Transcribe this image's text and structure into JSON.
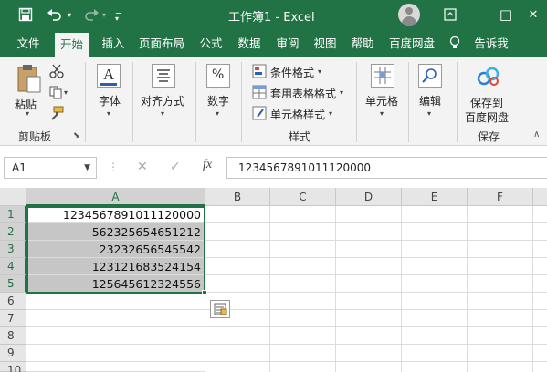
{
  "titlebar": {
    "title": "工作簿1  -  Excel",
    "save_icon": "save-icon",
    "undo_icon": "undo-icon",
    "redo_icon": "redo-icon",
    "customize_icon": "customize-quick-access-icon",
    "minimize_glyph": "—",
    "maximize_glyph": "□",
    "close_glyph": "✕",
    "display_options_glyph": "⊡"
  },
  "tabs": [
    {
      "label": "文件"
    },
    {
      "label": "开始"
    },
    {
      "label": "插入"
    },
    {
      "label": "页面布局"
    },
    {
      "label": "公式"
    },
    {
      "label": "数据"
    },
    {
      "label": "审阅"
    },
    {
      "label": "视图"
    },
    {
      "label": "帮助"
    },
    {
      "label": "百度网盘"
    },
    {
      "label": "告诉我"
    }
  ],
  "ribbon": {
    "clipboard": {
      "paste": "粘贴",
      "group": "剪贴板"
    },
    "font": {
      "label": "字体"
    },
    "alignment": {
      "label": "对齐方式"
    },
    "number": {
      "label": "数字"
    },
    "styles": {
      "conditional": "条件格式",
      "table": "套用表格格式",
      "cell_styles": "单元格样式",
      "group": "样式"
    },
    "cells": {
      "label": "单元格"
    },
    "editing": {
      "label": "编辑"
    },
    "save": {
      "label_line1": "保存到",
      "label_line2": "百度网盘",
      "group": "保存"
    }
  },
  "formula_bar": {
    "name_box": "A1",
    "cancel_glyph": "✕",
    "enter_glyph": "✓",
    "fx_label": "fx",
    "formula": "1234567891011120000"
  },
  "sheet": {
    "columns": [
      "A",
      "B",
      "C",
      "D",
      "E",
      "F"
    ],
    "rows": [
      "1",
      "2",
      "3",
      "4",
      "5",
      "6",
      "7",
      "8",
      "9",
      "10"
    ],
    "values": [
      "1234567891011120000",
      "562325654651212",
      "23232656545542",
      "123121683524154",
      "125645612324556"
    ]
  },
  "colors": {
    "accent": "#217346",
    "ribbon_bg": "#f3f3f3",
    "selection_fill": "#c6c6c6"
  }
}
